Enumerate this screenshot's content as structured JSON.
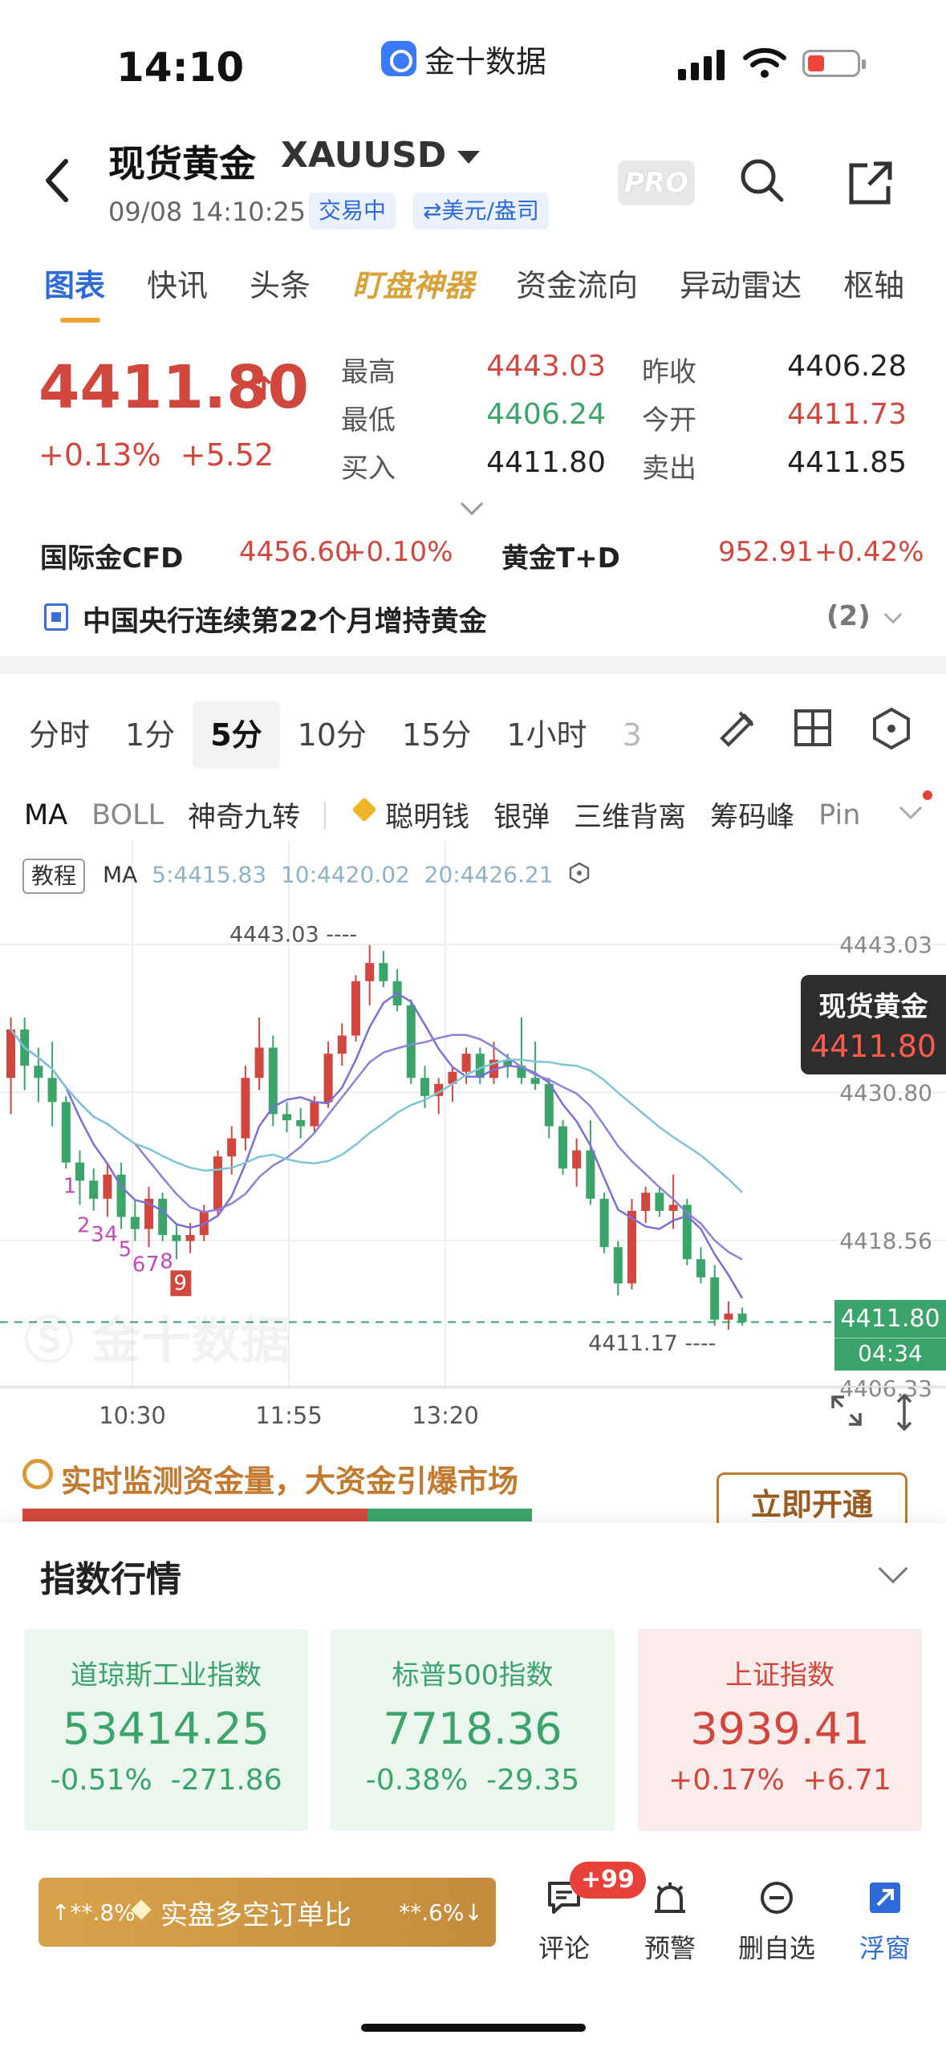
{
  "status_bar": {
    "time": "14:10",
    "app_name": "金十数据"
  },
  "header": {
    "title": "现货黄金",
    "symbol": "XAUUSD",
    "datetime": "09/08 14:10:25",
    "tag_trading": "交易中",
    "tag_unit": "⇄美元/盎司",
    "pro_label": "PRO"
  },
  "tabs": [
    {
      "label": "图表"
    },
    {
      "label": "快讯"
    },
    {
      "label": "头条"
    },
    {
      "label": "盯盘神器"
    },
    {
      "label": "资金流向"
    },
    {
      "label": "异动雷达"
    },
    {
      "label": "枢轴"
    }
  ],
  "quote": {
    "price": "4411.80",
    "change_pct": "+0.13%",
    "change_abs": "+5.52",
    "high_label": "最高",
    "high": "4443.03",
    "low_label": "最低",
    "low": "4406.24",
    "bid_label": "买入",
    "bid": "4411.80",
    "prev_close_label": "昨收",
    "prev_close": "4406.28",
    "open_label": "今开",
    "open": "4411.73",
    "ask_label": "卖出",
    "ask": "4411.85"
  },
  "related": {
    "cfd_label": "国际金CFD",
    "cfd_price": "4456.60",
    "cfd_change": "+0.10%",
    "td_label": "黄金T+D",
    "td_price": "952.91",
    "td_change": "+0.42%"
  },
  "news": {
    "text": "中国央行连续第22个月增持黄金",
    "count": "(2)"
  },
  "periods": [
    "分时",
    "1分",
    "5分",
    "10分",
    "15分",
    "1小时",
    "3"
  ],
  "indicators": {
    "items": [
      "MA",
      "BOLL",
      "神奇九转"
    ],
    "tools": [
      "聪明钱",
      "银弹",
      "三维背离",
      "筹码峰",
      "Pin"
    ]
  },
  "chart_legend": {
    "tutorial": "教程",
    "ma_label": "MA",
    "ma5": "5:4415.83",
    "ma10": "10:4420.02",
    "ma20": "20:4426.21"
  },
  "chart_data": {
    "type": "candlestick",
    "title": "",
    "y_axis_labels": [
      "4443.03",
      "4430.80",
      "4418.56",
      "4406.33"
    ],
    "ylim": [
      4406.33,
      4443.03
    ],
    "x_tick_labels": [
      "10:30",
      "11:55",
      "13:20"
    ],
    "max_marker": "4443.03",
    "min_marker": "4411.17",
    "current_price": "4411.80",
    "countdown": "04:34",
    "price_tag_name": "现货黄金",
    "price_tag_value": "4411.80",
    "td_sequence_labels": [
      "1",
      "2",
      "3",
      "4",
      "5",
      "6",
      "7",
      "8",
      "9"
    ],
    "colors": {
      "up": "#d2473d",
      "down": "#3aa46b",
      "ma5": "#7b6fd8",
      "ma10": "#8a84d8",
      "ma20": "#7fc4d4"
    },
    "candles": [
      {
        "o": 4432.0,
        "h": 4437.0,
        "l": 4429.0,
        "c": 4436.0
      },
      {
        "o": 4436.0,
        "h": 4437.0,
        "l": 4431.0,
        "c": 4433.0
      },
      {
        "o": 4433.0,
        "h": 4434.5,
        "l": 4430.0,
        "c": 4432.0
      },
      {
        "o": 4432.0,
        "h": 4435.0,
        "l": 4428.0,
        "c": 4430.0
      },
      {
        "o": 4430.0,
        "h": 4430.5,
        "l": 4424.5,
        "c": 4425.0
      },
      {
        "o": 4425.0,
        "h": 4426.0,
        "l": 4421.5,
        "c": 4423.5
      },
      {
        "o": 4423.5,
        "h": 4424.5,
        "l": 4421.0,
        "c": 4422.0
      },
      {
        "o": 4422.0,
        "h": 4425.0,
        "l": 4420.5,
        "c": 4424.0
      },
      {
        "o": 4424.0,
        "h": 4425.0,
        "l": 4419.5,
        "c": 4420.5
      },
      {
        "o": 4420.5,
        "h": 4422.0,
        "l": 4418.5,
        "c": 4419.5
      },
      {
        "o": 4419.5,
        "h": 4423.0,
        "l": 4418.0,
        "c": 4422.0
      },
      {
        "o": 4422.0,
        "h": 4422.5,
        "l": 4418.5,
        "c": 4419.0
      },
      {
        "o": 4419.0,
        "h": 4420.0,
        "l": 4417.0,
        "c": 4418.5
      },
      {
        "o": 4418.5,
        "h": 4420.0,
        "l": 4417.5,
        "c": 4419.0
      },
      {
        "o": 4419.0,
        "h": 4421.5,
        "l": 4418.5,
        "c": 4421.0
      },
      {
        "o": 4421.0,
        "h": 4426.0,
        "l": 4420.5,
        "c": 4425.5
      },
      {
        "o": 4425.5,
        "h": 4428.0,
        "l": 4424.0,
        "c": 4427.0
      },
      {
        "o": 4427.0,
        "h": 4433.0,
        "l": 4426.0,
        "c": 4432.0
      },
      {
        "o": 4432.0,
        "h": 4437.0,
        "l": 4431.0,
        "c": 4434.5
      },
      {
        "o": 4434.5,
        "h": 4435.5,
        "l": 4428.0,
        "c": 4429.0
      },
      {
        "o": 4429.0,
        "h": 4430.0,
        "l": 4427.5,
        "c": 4428.5
      },
      {
        "o": 4428.5,
        "h": 4429.5,
        "l": 4427.0,
        "c": 4428.0
      },
      {
        "o": 4428.0,
        "h": 4430.5,
        "l": 4427.5,
        "c": 4430.0
      },
      {
        "o": 4430.0,
        "h": 4435.0,
        "l": 4429.5,
        "c": 4434.0
      },
      {
        "o": 4434.0,
        "h": 4436.5,
        "l": 4433.0,
        "c": 4435.5
      },
      {
        "o": 4435.5,
        "h": 4440.5,
        "l": 4435.0,
        "c": 4440.0
      },
      {
        "o": 4440.0,
        "h": 4443.0,
        "l": 4438.0,
        "c": 4441.5
      },
      {
        "o": 4441.5,
        "h": 4442.5,
        "l": 4439.5,
        "c": 4440.0
      },
      {
        "o": 4440.0,
        "h": 4441.0,
        "l": 4437.5,
        "c": 4438.0
      },
      {
        "o": 4438.0,
        "h": 4438.5,
        "l": 4431.5,
        "c": 4432.0
      },
      {
        "o": 4432.0,
        "h": 4433.0,
        "l": 4429.5,
        "c": 4430.5
      },
      {
        "o": 4430.5,
        "h": 4432.0,
        "l": 4429.0,
        "c": 4431.5
      },
      {
        "o": 4431.5,
        "h": 4433.0,
        "l": 4430.0,
        "c": 4432.5
      },
      {
        "o": 4432.5,
        "h": 4434.5,
        "l": 4431.5,
        "c": 4434.0
      },
      {
        "o": 4434.0,
        "h": 4434.5,
        "l": 4431.5,
        "c": 4432.0
      },
      {
        "o": 4432.0,
        "h": 4435.0,
        "l": 4431.5,
        "c": 4433.5
      },
      {
        "o": 4433.5,
        "h": 4434.0,
        "l": 4432.0,
        "c": 4433.0
      },
      {
        "o": 4433.0,
        "h": 4437.0,
        "l": 4431.5,
        "c": 4432.0
      },
      {
        "o": 4432.0,
        "h": 4435.0,
        "l": 4431.0,
        "c": 4431.5
      },
      {
        "o": 4431.5,
        "h": 4432.0,
        "l": 4427.0,
        "c": 4428.0
      },
      {
        "o": 4428.0,
        "h": 4428.5,
        "l": 4424.0,
        "c": 4424.5
      },
      {
        "o": 4424.5,
        "h": 4427.0,
        "l": 4423.0,
        "c": 4426.0
      },
      {
        "o": 4426.0,
        "h": 4428.5,
        "l": 4421.5,
        "c": 4422.0
      },
      {
        "o": 4422.0,
        "h": 4422.5,
        "l": 4417.5,
        "c": 4418.0
      },
      {
        "o": 4418.0,
        "h": 4418.5,
        "l": 4414.0,
        "c": 4415.0
      },
      {
        "o": 4415.0,
        "h": 4422.0,
        "l": 4414.5,
        "c": 4421.0
      },
      {
        "o": 4421.0,
        "h": 4423.0,
        "l": 4420.0,
        "c": 4422.5
      },
      {
        "o": 4422.5,
        "h": 4423.0,
        "l": 4420.5,
        "c": 4421.0
      },
      {
        "o": 4421.0,
        "h": 4424.0,
        "l": 4419.5,
        "c": 4421.5
      },
      {
        "o": 4421.5,
        "h": 4422.0,
        "l": 4416.5,
        "c": 4417.0
      },
      {
        "o": 4417.0,
        "h": 4418.0,
        "l": 4415.0,
        "c": 4415.5
      },
      {
        "o": 4415.5,
        "h": 4416.5,
        "l": 4411.5,
        "c": 4412.0
      },
      {
        "o": 4412.0,
        "h": 4413.5,
        "l": 4411.17,
        "c": 4412.5
      },
      {
        "o": 4412.5,
        "h": 4413.0,
        "l": 4411.5,
        "c": 4411.8
      }
    ]
  },
  "ad": {
    "text": "实时监测资金量，大资金引爆市场",
    "button": "立即开通"
  },
  "index_section": {
    "title": "指数行情",
    "cards": [
      {
        "name": "道琼斯工业指数",
        "value": "53414.25",
        "pct": "-0.51%",
        "abs": "-271.86",
        "trend": "down"
      },
      {
        "name": "标普500指数",
        "value": "7718.36",
        "pct": "-0.38%",
        "abs": "-29.35",
        "trend": "down"
      },
      {
        "name": "上证指数",
        "value": "3939.41",
        "pct": "+0.17%",
        "abs": "+6.71",
        "trend": "up"
      }
    ]
  },
  "bottom_bar": {
    "long_pct": "↑**.8%",
    "ls_label": "实盘多空订单比",
    "short_pct": "**.6%↓",
    "badge": "+99",
    "items": [
      {
        "label": "评论"
      },
      {
        "label": "预警"
      },
      {
        "label": "删自选"
      },
      {
        "label": "浮窗"
      }
    ]
  }
}
